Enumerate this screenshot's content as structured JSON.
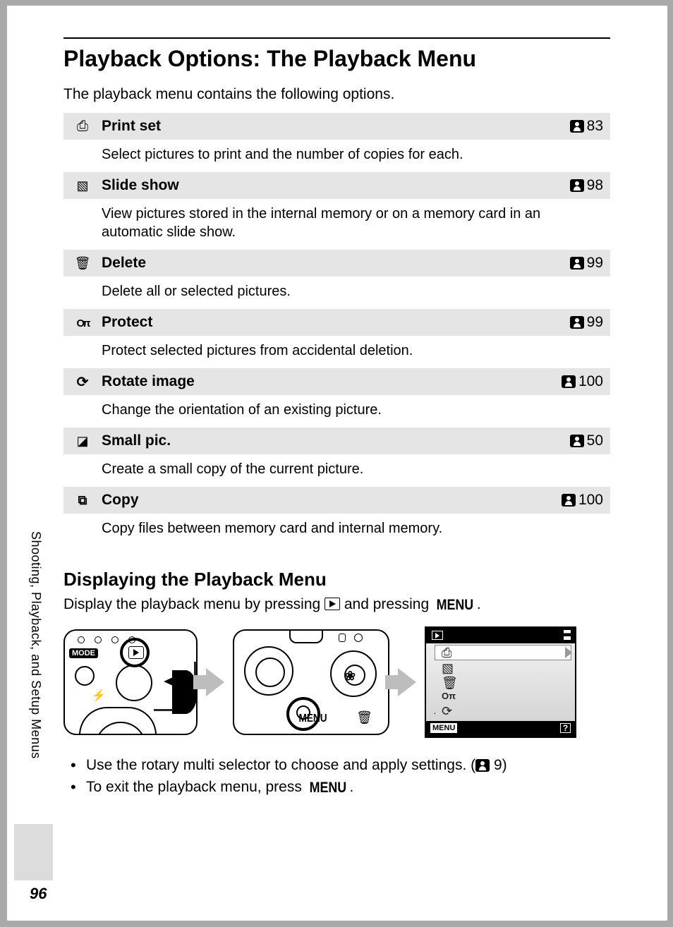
{
  "page_number": "96",
  "sidebar_section": "Shooting, Playback, and Setup Menus",
  "heading": "Playback Options: The Playback Menu",
  "intro": "The playback menu contains the following options.",
  "options": [
    {
      "icon": "print-set-icon",
      "label": "Print set",
      "page_ref": "83",
      "desc": "Select pictures to print and the number of copies for each."
    },
    {
      "icon": "slide-show-icon",
      "label": "Slide show",
      "page_ref": "98",
      "desc": "View pictures stored in the internal memory or on a memory card in an automatic slide show."
    },
    {
      "icon": "delete-icon",
      "label": "Delete",
      "page_ref": "99",
      "desc": "Delete all or selected pictures."
    },
    {
      "icon": "protect-icon",
      "label": "Protect",
      "page_ref": "99",
      "desc": "Protect selected pictures from accidental deletion."
    },
    {
      "icon": "rotate-image-icon",
      "label": "Rotate image",
      "page_ref": "100",
      "desc": "Change the orientation of an existing picture."
    },
    {
      "icon": "small-pic-icon",
      "label": "Small pic.",
      "page_ref": "50",
      "desc": "Create a small copy of the current picture."
    },
    {
      "icon": "copy-icon",
      "label": "Copy",
      "page_ref": "100",
      "desc": "Copy files between memory card and internal memory."
    }
  ],
  "subheading": "Displaying the Playback Menu",
  "display_instruction_pre": "Display the playback menu by pressing ",
  "display_instruction_mid": " and pressing ",
  "display_instruction_post": ".",
  "menu_word": "MENU",
  "diagram": {
    "camera1": {
      "mode_label": "MODE",
      "flash_glyph": "⚡"
    },
    "camera2": {
      "menu_label": "MENU",
      "macro_glyph": "❀",
      "delete_glyph": "🗑"
    },
    "screen": {
      "menu_bottom": "MENU",
      "help_glyph": "?",
      "icons": [
        "⎙",
        "▧",
        "🗑",
        "Oπ",
        "⟳"
      ],
      "dot": "·"
    }
  },
  "bullets": [
    {
      "pre": "Use the rotary multi selector to choose and apply settings. (",
      "ref": "9",
      "post": ")"
    },
    {
      "pre": "To exit the playback menu, press ",
      "menu": true,
      "post": "."
    }
  ]
}
